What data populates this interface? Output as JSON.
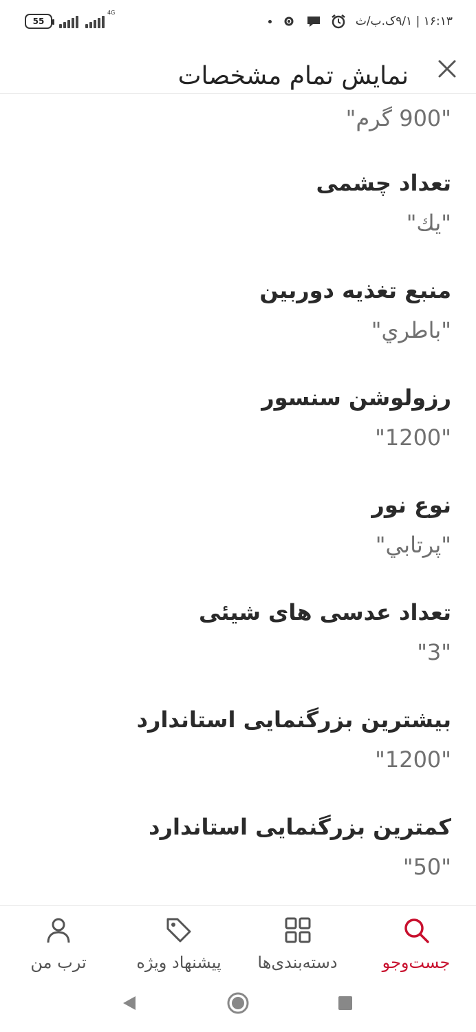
{
  "status_bar": {
    "battery_level": "55",
    "network_type": "4G",
    "time_date": "۱۶:۱۳ | ۹/۱ک.ب/ث"
  },
  "header": {
    "title": "نمایش تمام مشخصات",
    "close_icon": "close-icon"
  },
  "top_value": "\"900 گرم\"",
  "specs": [
    {
      "label": "تعداد چشمی",
      "value": "\"یك\""
    },
    {
      "label": "منبع تغذیه دوربین",
      "value": "\"باطري\""
    },
    {
      "label": "رزولوشن سنسور",
      "value": "\"1200\""
    },
    {
      "label": "نوع نور",
      "value": "\"پرتابي\""
    },
    {
      "label": "تعداد عدسی های شیئی",
      "value": "\"3\""
    },
    {
      "label": "بیشترین بزرگنمایی استاندارد",
      "value": "\"1200\""
    },
    {
      "label": "کمترین بزرگنمایی استاندارد",
      "value": "\"50\""
    }
  ],
  "bottom_nav": {
    "active_color": "#c8102e",
    "items": [
      {
        "label": "جست‌وجو",
        "icon": "search-icon",
        "active": true
      },
      {
        "label": "دسته‌بندی‌ها",
        "icon": "grid-icon",
        "active": false
      },
      {
        "label": "پیشنهاد ویژه",
        "icon": "tag-icon",
        "active": false
      },
      {
        "label": "ترب من",
        "icon": "user-icon",
        "active": false
      }
    ]
  }
}
